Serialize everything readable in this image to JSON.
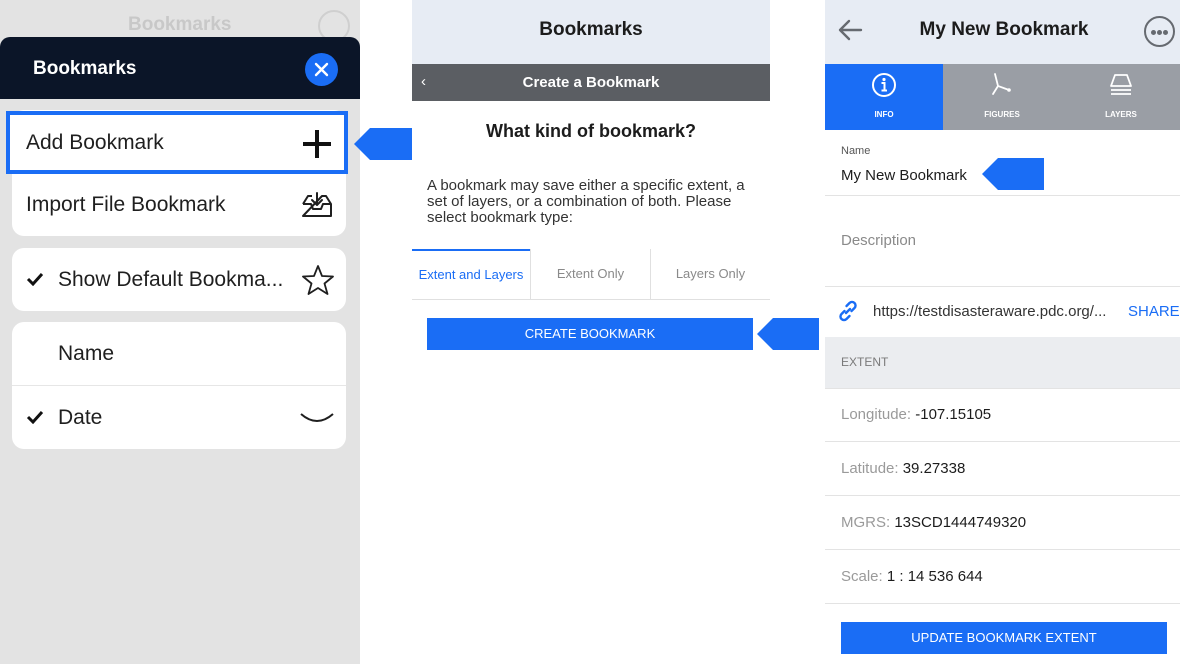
{
  "panel_bookmarks": {
    "ghost_title": "Bookmarks",
    "title": "Bookmarks",
    "add_bookmark": "Add Bookmark",
    "import_file_bookmark": "Import File Bookmark",
    "show_default_bookmarks": "Show Default Bookma...",
    "sort_name": "Name",
    "sort_date": "Date",
    "accent_color": "#1a6df5",
    "header_color": "#0b1528"
  },
  "panel_create": {
    "title": "Bookmarks",
    "back_glyph": "‹",
    "subtitle": "Create a Bookmark",
    "question": "What kind of bookmark?",
    "description": "A bookmark may save either a specific extent, a set of layers, or a combination of both. Please select bookmark type:",
    "tabs": [
      "Extent and Layers",
      "Extent Only",
      "Layers Only"
    ],
    "active_tab": "Extent and Layers",
    "create_button": "CREATE BOOKMARK"
  },
  "panel_detail": {
    "title": "My New Bookmark",
    "tabs": [
      "INFO",
      "FIGURES",
      "LAYERS"
    ],
    "active_tab": "INFO",
    "name_label": "Name",
    "name_value": "My New Bookmark",
    "description_placeholder": "Description",
    "link": "https://testdisasteraware.pdc.org/...",
    "share": "SHARE",
    "extent_header": "EXTENT",
    "longitude_label": "Longitude: ",
    "longitude_value": "-107.15105",
    "latitude_label": "Latitude: ",
    "latitude_value": "39.27338",
    "mgrs_label": "MGRS: ",
    "mgrs_value": "13SCD1444749320",
    "scale_label": "Scale: ",
    "scale_value": "1 : 14 536 644",
    "update_button": "UPDATE BOOKMARK EXTENT"
  },
  "icons": [
    "close-icon",
    "plus-icon",
    "inbox-download-icon",
    "check-icon",
    "star-icon",
    "chevron-down-icon",
    "back-arrow-icon",
    "more-icon",
    "info-icon",
    "figures-icon",
    "layers-icon",
    "link-icon",
    "pointer-arrow-icon"
  ]
}
